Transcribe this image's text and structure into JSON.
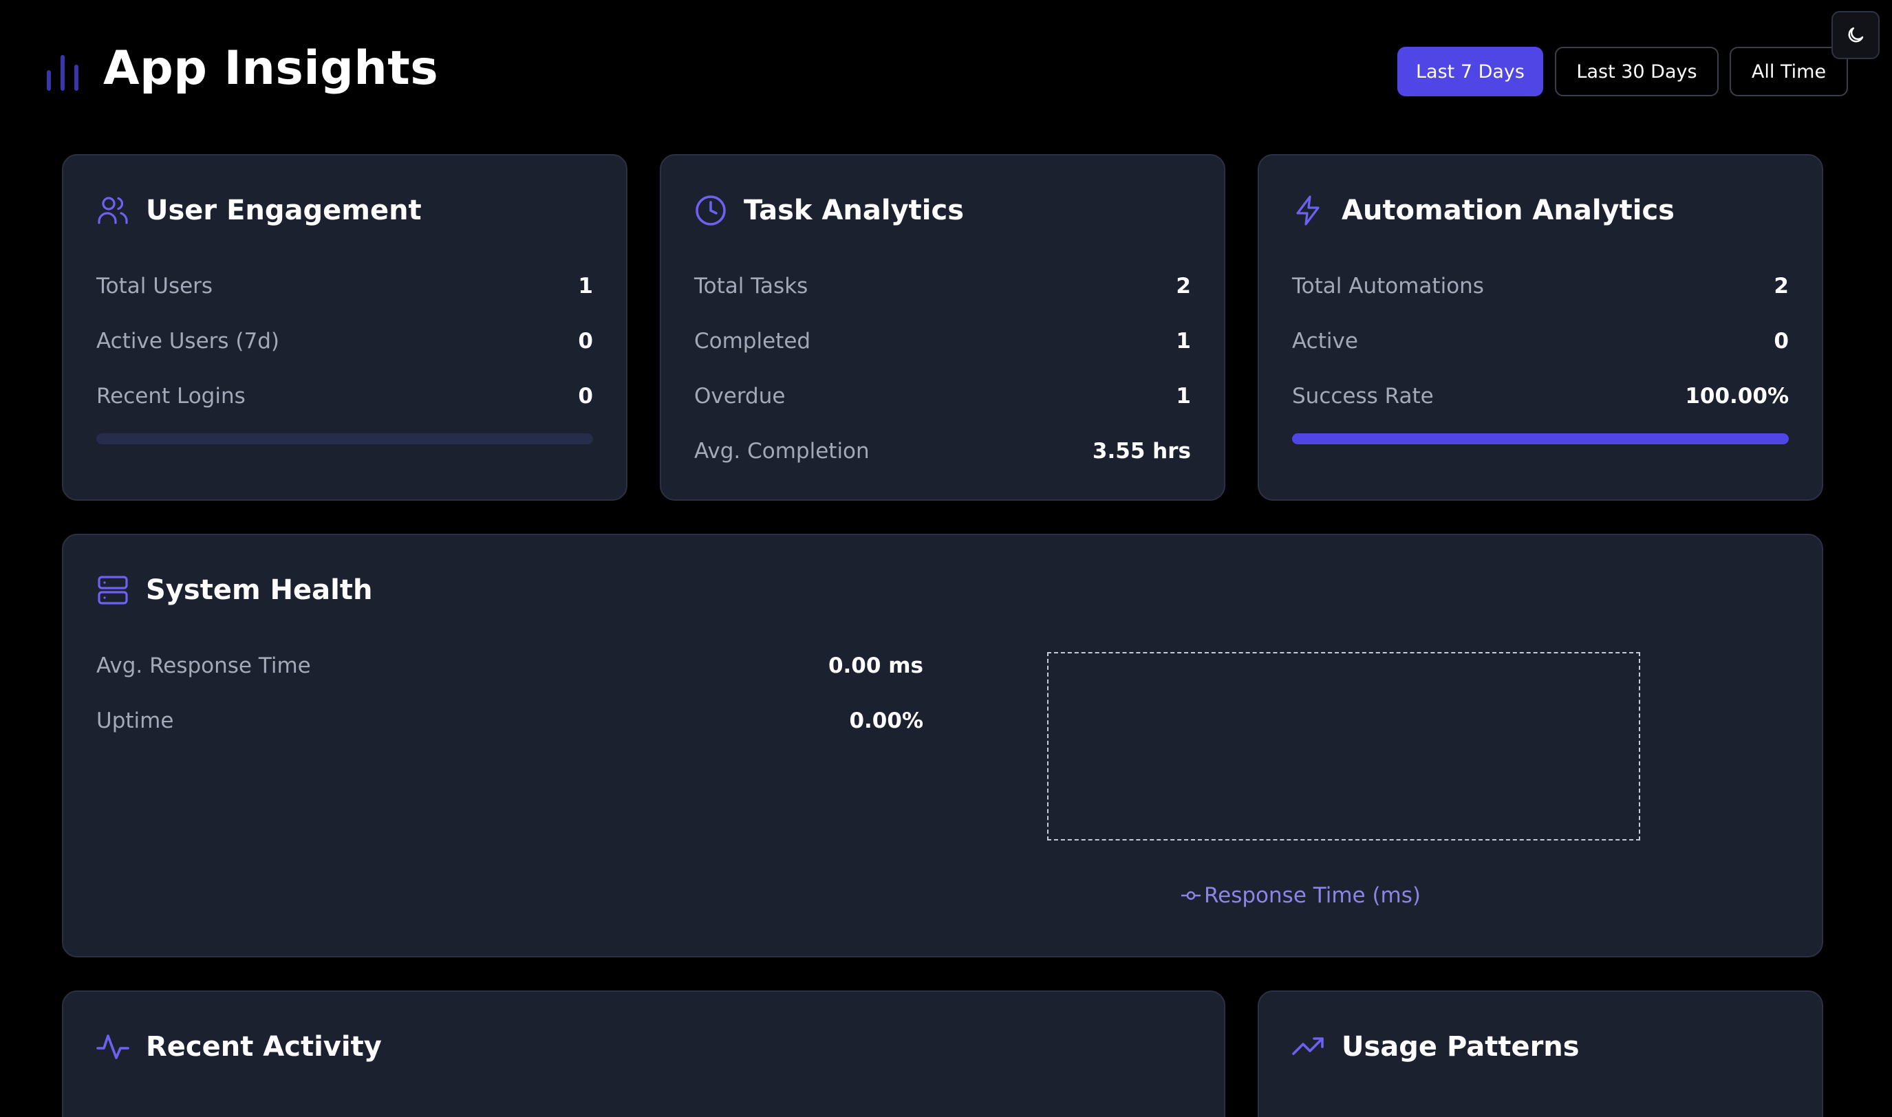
{
  "header": {
    "title": "App Insights",
    "logo_icon": "bar-chart-icon",
    "range_buttons": [
      {
        "label": "Last 7 Days",
        "active": true
      },
      {
        "label": "Last 30 Days",
        "active": false
      },
      {
        "label": "All Time",
        "active": false
      }
    ],
    "theme_toggle_icon": "moon-icon"
  },
  "colors": {
    "accent": "#4f46e5",
    "card_bg": "#1c2130",
    "page_bg": "#000000",
    "muted_text": "#a3a9b8"
  },
  "user_engagement": {
    "title": "User Engagement",
    "icon": "users-icon",
    "stats": [
      {
        "label": "Total Users",
        "value": "1"
      },
      {
        "label": "Active Users (7d)",
        "value": "0"
      },
      {
        "label": "Recent Logins",
        "value": "0"
      }
    ],
    "progress": 0
  },
  "task_analytics": {
    "title": "Task Analytics",
    "icon": "clock-icon",
    "stats": [
      {
        "label": "Total Tasks",
        "value": "2"
      },
      {
        "label": "Completed",
        "value": "1"
      },
      {
        "label": "Overdue",
        "value": "1"
      },
      {
        "label": "Avg. Completion",
        "value": "3.55 hrs"
      }
    ]
  },
  "automation_analytics": {
    "title": "Automation Analytics",
    "icon": "lightning-icon",
    "stats": [
      {
        "label": "Total Automations",
        "value": "2"
      },
      {
        "label": "Active",
        "value": "0"
      },
      {
        "label": "Success Rate",
        "value": "100.00%"
      }
    ],
    "progress": 1.0
  },
  "system_health": {
    "title": "System Health",
    "icon": "server-icon",
    "stats": [
      {
        "label": "Avg. Response Time",
        "value": "0.00 ms"
      },
      {
        "label": "Uptime",
        "value": "0.00%"
      }
    ],
    "chart_legend": "Response Time (ms)"
  },
  "recent_activity": {
    "title": "Recent Activity",
    "icon": "activity-icon"
  },
  "usage_patterns": {
    "title": "Usage Patterns",
    "icon": "trending-up-icon"
  }
}
